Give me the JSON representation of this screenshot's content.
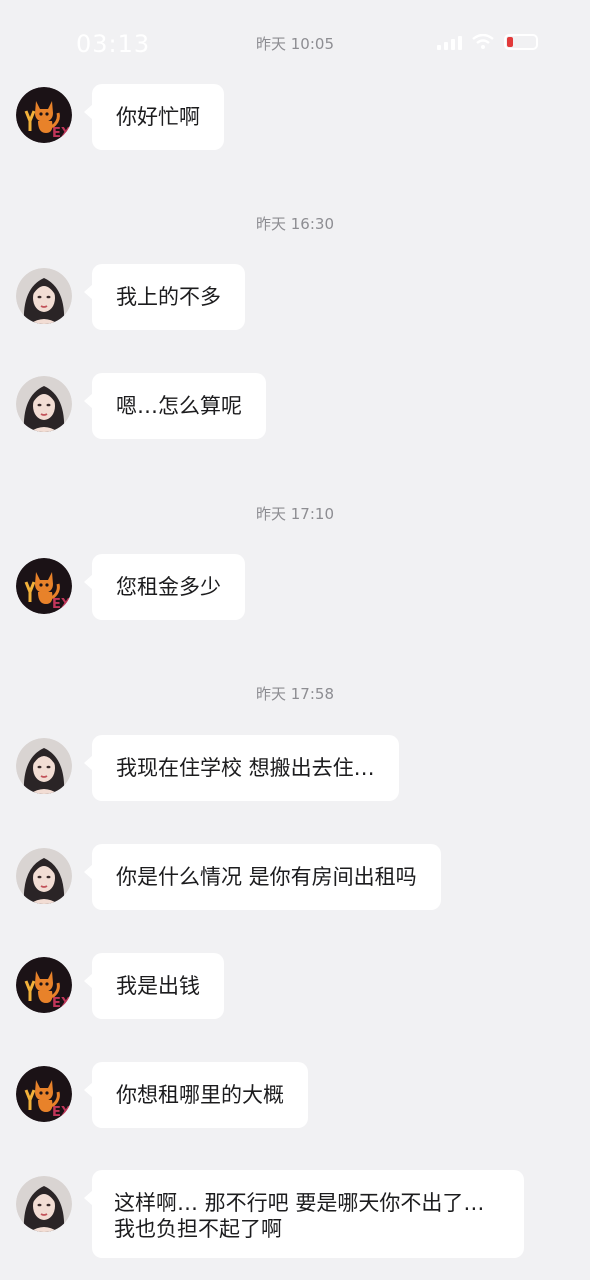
{
  "status_bar": {
    "time": "03:13"
  },
  "colors": {
    "background": "#f1f1f3",
    "bubble": "#ffffff",
    "timestamp": "#8d8d92"
  },
  "icons": {
    "contact_a_avatar": "cat-logo-avatar",
    "contact_b_avatar": "profile-photo-avatar"
  },
  "timestamps": [
    "昨天 10:05",
    "昨天 16:30",
    "昨天 17:10",
    "昨天 17:58"
  ],
  "messages": [
    {
      "sender": "cat",
      "text": "你好忙啊"
    },
    {
      "sender": "girl",
      "text": "我上的不多"
    },
    {
      "sender": "girl",
      "text": "嗯…怎么算呢"
    },
    {
      "sender": "cat",
      "text": "您租金多少"
    },
    {
      "sender": "girl",
      "text": "我现在住学校 想搬出去住…"
    },
    {
      "sender": "girl",
      "text": "你是什么情况 是你有房间出租吗"
    },
    {
      "sender": "cat",
      "text": "我是出钱"
    },
    {
      "sender": "cat",
      "text": "你想租哪里的大概"
    },
    {
      "sender": "girl",
      "text": "这样啊… 那不行吧 要是哪天你不出了…我也负担不起了啊"
    }
  ]
}
